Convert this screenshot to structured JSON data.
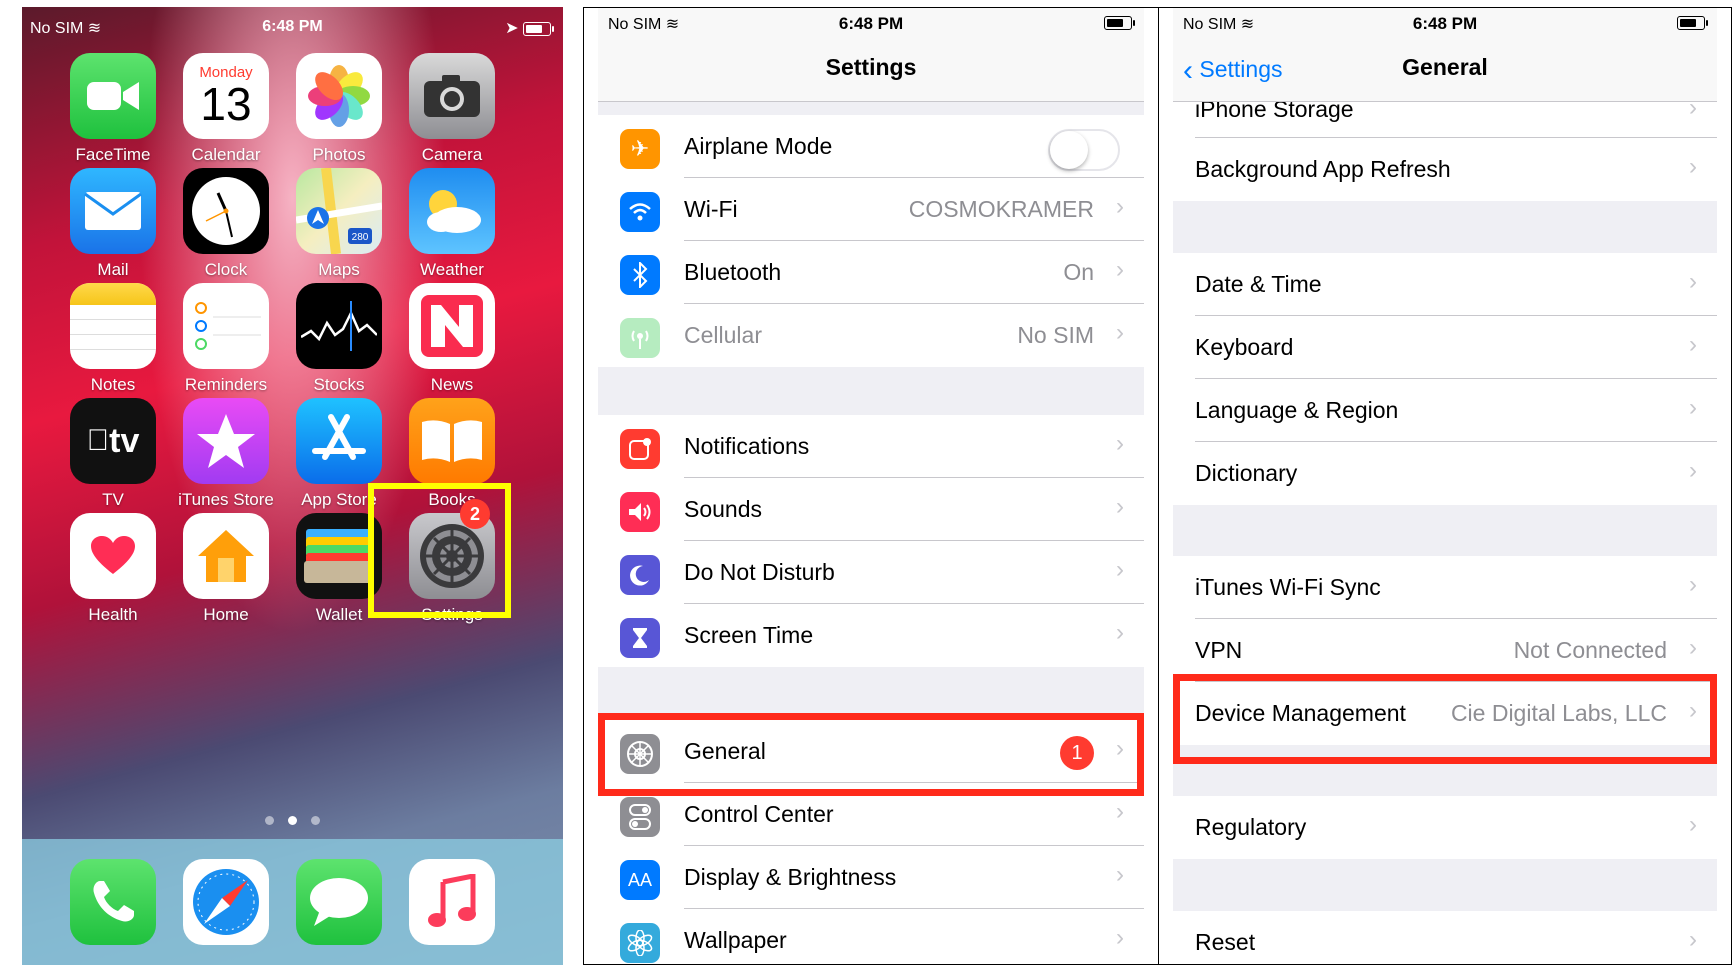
{
  "panel1": {
    "status": {
      "carrier": "No SIM",
      "time": "6:48 PM"
    },
    "apps": [
      {
        "label": "FaceTime"
      },
      {
        "label": "Calendar",
        "day": "Monday",
        "date": "13"
      },
      {
        "label": "Photos"
      },
      {
        "label": "Camera"
      },
      {
        "label": "Mail"
      },
      {
        "label": "Clock"
      },
      {
        "label": "Maps",
        "shield": "280"
      },
      {
        "label": "Weather"
      },
      {
        "label": "Notes"
      },
      {
        "label": "Reminders"
      },
      {
        "label": "Stocks"
      },
      {
        "label": "News"
      },
      {
        "label": "TV",
        "icon_text": "tv"
      },
      {
        "label": "iTunes Store"
      },
      {
        "label": "App Store"
      },
      {
        "label": "Books"
      },
      {
        "label": "Health"
      },
      {
        "label": "Home"
      },
      {
        "label": "Wallet"
      },
      {
        "label": "Settings",
        "badge": "2"
      }
    ],
    "dock": [
      "phone-icon",
      "safari-icon",
      "messages-icon",
      "music-icon"
    ],
    "page_dots": 3,
    "active_dot": 1,
    "highlight_color": "#ffff00"
  },
  "panel2": {
    "status": {
      "carrier": "No SIM",
      "time": "6:48 PM"
    },
    "title": "Settings",
    "group1": [
      {
        "label": "Airplane Mode",
        "color": "#ff9500",
        "icon": "airplane-icon",
        "toggle": false
      },
      {
        "label": "Wi-Fi",
        "value": "COSMOKRAMER",
        "color": "#007aff",
        "icon": "wifi-icon"
      },
      {
        "label": "Bluetooth",
        "value": "On",
        "color": "#007aff",
        "icon": "bluetooth-icon"
      },
      {
        "label": "Cellular",
        "value": "No SIM",
        "color": "#4cd964",
        "icon": "cellular-icon",
        "disabled": true
      }
    ],
    "group2": [
      {
        "label": "Notifications",
        "color": "#ff3b30",
        "icon": "notifications-icon"
      },
      {
        "label": "Sounds",
        "color": "#ff2d55",
        "icon": "sounds-icon"
      },
      {
        "label": "Do Not Disturb",
        "color": "#5856d6",
        "icon": "moon-icon"
      },
      {
        "label": "Screen Time",
        "color": "#5856d6",
        "icon": "hourglass-icon"
      }
    ],
    "group3": [
      {
        "label": "General",
        "badge": "1",
        "color": "#8e8e93",
        "icon": "gear-icon"
      },
      {
        "label": "Control Center",
        "color": "#8e8e93",
        "icon": "switches-icon"
      },
      {
        "label": "Display & Brightness",
        "color": "#007aff",
        "icon": "aa-icon",
        "icon_text": "AA"
      },
      {
        "label": "Wallpaper",
        "color": "#34aadc",
        "icon": "flower-icon"
      }
    ],
    "highlight_color": "#ff2a1a"
  },
  "panel3": {
    "status": {
      "carrier": "No SIM",
      "time": "6:48 PM"
    },
    "back_label": "Settings",
    "title": "General",
    "partial_row": "iPhone Storage",
    "rows_a": [
      {
        "label": "Background App Refresh"
      }
    ],
    "rows_b": [
      {
        "label": "Date & Time"
      },
      {
        "label": "Keyboard"
      },
      {
        "label": "Language & Region"
      },
      {
        "label": "Dictionary"
      }
    ],
    "rows_c": [
      {
        "label": "iTunes Wi-Fi Sync"
      },
      {
        "label": "VPN",
        "value": "Not Connected"
      },
      {
        "label": "Device Management",
        "value": "Cie Digital Labs, LLC"
      }
    ],
    "rows_d": [
      {
        "label": "Regulatory"
      }
    ],
    "rows_e": [
      {
        "label": "Reset"
      }
    ],
    "highlight_color": "#ff2a1a"
  }
}
